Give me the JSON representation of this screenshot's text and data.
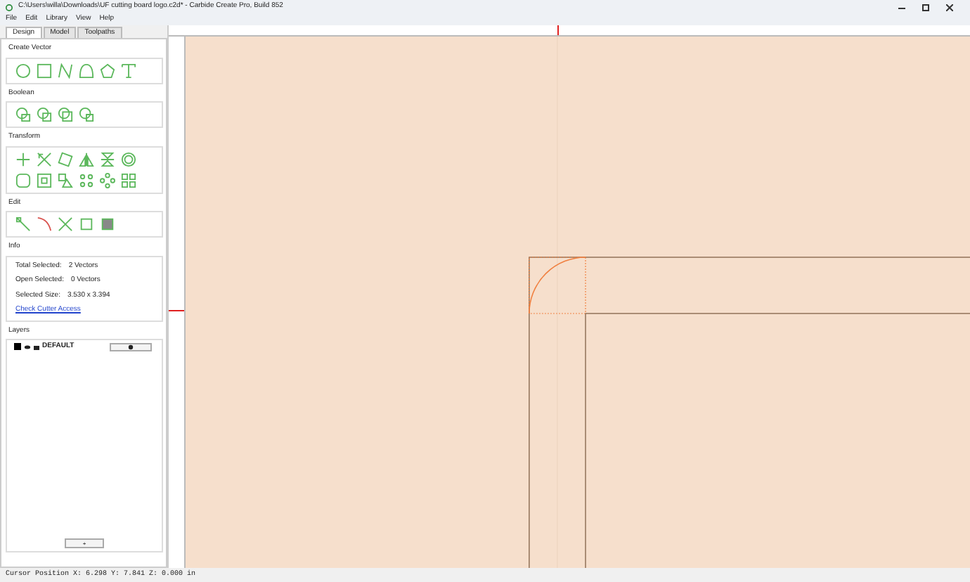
{
  "window": {
    "title": "C:\\Users\\willa\\Downloads\\UF cutting board logo.c2d* - Carbide Create Pro, Build 852"
  },
  "menu": [
    "File",
    "Edit",
    "Library",
    "View",
    "Help"
  ],
  "tabs": [
    {
      "label": "Design",
      "selected": true
    },
    {
      "label": "Model",
      "selected": false
    },
    {
      "label": "Toolpaths",
      "selected": false
    }
  ],
  "sections": [
    {
      "title": "Create Vector"
    },
    {
      "title": "Boolean"
    },
    {
      "title": "Transform"
    },
    {
      "title": "Edit"
    }
  ],
  "info": {
    "title": "Info",
    "lines": [
      {
        "label": "Total Selected:",
        "value": "2 Vectors"
      },
      {
        "label": "Open Selected:",
        "value": "0 Vectors"
      },
      {
        "label": "Selected Size:",
        "value": "3.530 x 3.394"
      }
    ],
    "link": "Check Cutter Access"
  },
  "layers": {
    "title": "Layers",
    "items": [
      {
        "name": "DEFAULT",
        "color": "#000000"
      }
    ],
    "add_button": "+"
  },
  "status_bar": "Cursor Position X: 6.298 Y: 7.841 Z: 0.000 in"
}
